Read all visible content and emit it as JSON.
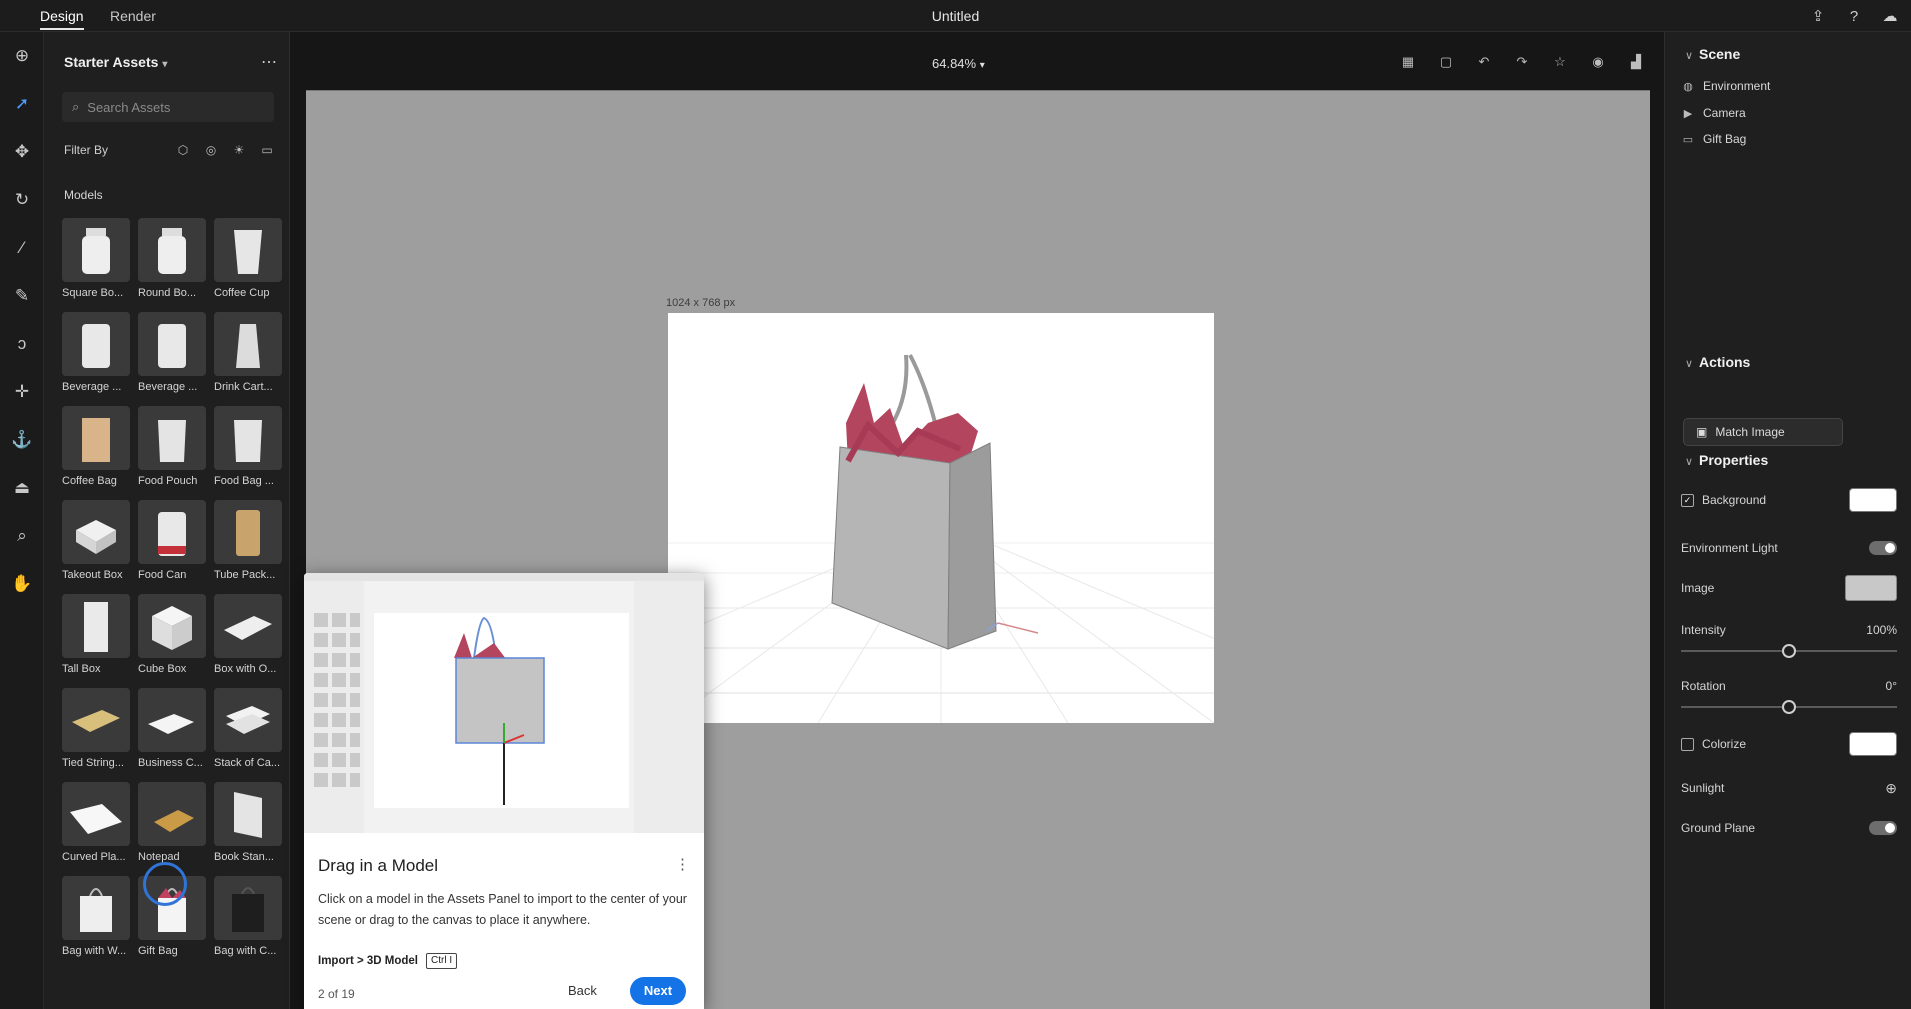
{
  "topbar": {
    "tabs": [
      {
        "label": "Design",
        "active": true
      },
      {
        "label": "Render",
        "active": false
      }
    ],
    "doc_title": "Untitled",
    "icons": [
      "share-icon",
      "help-icon",
      "cloud-icon"
    ]
  },
  "toolbar": {
    "tools": [
      "add-icon",
      "select-icon",
      "move-icon",
      "orbit-icon",
      "magic-wand-icon",
      "eyedropper-icon",
      "lasso-icon",
      "crosshair-icon",
      "anchor-icon",
      "camera-tripod-icon",
      "zoom-icon",
      "hand-icon"
    ]
  },
  "assets": {
    "title": "Starter Assets",
    "search_placeholder": "Search Assets",
    "filter_label": "Filter By",
    "section_label": "Models",
    "items": [
      "Square Bo...",
      "Round Bo...",
      "Coffee Cup",
      "Beverage ...",
      "Beverage ...",
      "Drink Cart...",
      "Coffee Bag",
      "Food Pouch",
      "Food Bag ...",
      "Takeout Box",
      "Food Can",
      "Tube Pack...",
      "Tall Box",
      "Cube Box",
      "Box with O...",
      "Tied String...",
      "Business C...",
      "Stack of Ca...",
      "Curved Pla...",
      "Notepad",
      "Book Stan...",
      "Bag with W...",
      "Gift Bag",
      "Bag with C..."
    ]
  },
  "canvas": {
    "zoom": "64.84%",
    "artboard_size": "1024 x 768 px"
  },
  "right": {
    "scene_title": "Scene",
    "scene_items": [
      {
        "icon": "globe-icon",
        "label": "Environment"
      },
      {
        "icon": "camera-icon",
        "label": "Camera"
      },
      {
        "icon": "folder-icon",
        "label": "Gift Bag"
      }
    ],
    "actions_title": "Actions",
    "match_image": "Match Image",
    "properties_title": "Properties",
    "background": "Background",
    "environment_light": "Environment Light",
    "image": "Image",
    "intensity": "Intensity",
    "intensity_value": "100%",
    "intensity_level": 1.0,
    "rotation": "Rotation",
    "rotation_value": "0°",
    "rotation_level": 0.5,
    "colorize": "Colorize",
    "sunlight": "Sunlight",
    "ground_plane": "Ground Plane"
  },
  "popup": {
    "title": "Drag in a Model",
    "body": "Click on a model in the Assets Panel to import to the center of your scene or drag to the canvas to place it anywhere.",
    "shortcut_label": "Import > 3D Model",
    "shortcut_key": "Ctrl I",
    "step": "2 of 19",
    "back": "Back",
    "next": "Next"
  },
  "colors": {
    "accent": "#1473e6",
    "canvas_bg": "#9e9e9e",
    "bag_tissue": "#b3455f"
  }
}
